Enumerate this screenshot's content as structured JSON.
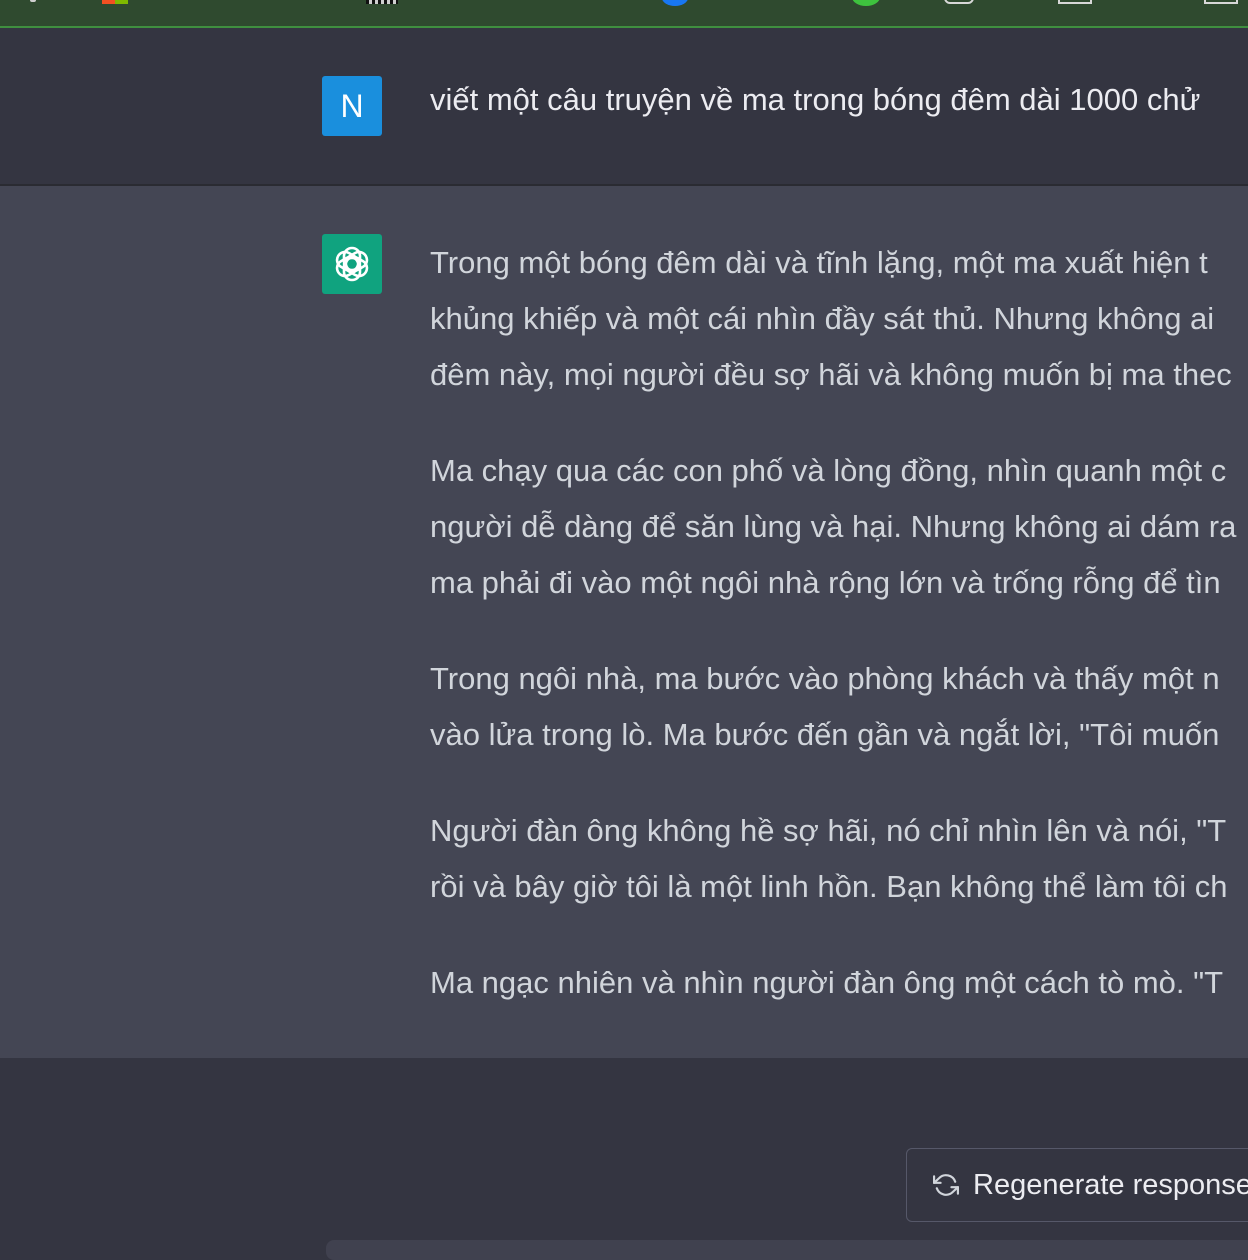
{
  "conversation": {
    "user_message": {
      "avatar_letter": "N",
      "text": "viết một câu truyện về ma trong bóng đêm dài 1000 chử"
    },
    "assistant_message": {
      "paragraphs": [
        [
          "Trong một bóng đêm dài và tĩnh lặng, một ma xuất hiện t",
          "khủng khiếp và một cái nhìn đầy sát thủ. Nhưng không ai",
          "đêm này, mọi người đều sợ hãi và không muốn bị ma thec"
        ],
        [
          "Ma chạy qua các con phố và lòng đồng, nhìn quanh một c",
          "người dễ dàng để săn lùng và hại. Nhưng không ai dám ra",
          "ma phải đi vào một ngôi nhà rộng lớn và trống rỗng để tìn"
        ],
        [
          "Trong ngôi nhà, ma bước vào phòng khách và thấy một n",
          "vào lửa trong lò. Ma bước đến gần và ngắt lời, \"Tôi muốn"
        ],
        [
          "Người đàn ông không hề sợ hãi, nó chỉ nhìn lên và nói, \"T",
          "rồi và bây giờ tôi là một linh hồn. Bạn không thể làm tôi ch"
        ],
        [
          "Ma ngạc nhiên và nhìn người đàn ông một cách tò mò. \"T"
        ]
      ]
    }
  },
  "actions": {
    "regenerate_label": "Regenerate response"
  },
  "colors": {
    "background": "#343541",
    "assistant_background": "#444654",
    "user_avatar": "#1a8fdd",
    "assistant_avatar": "#10a37f",
    "browser_bar": "#2f4a2f"
  }
}
